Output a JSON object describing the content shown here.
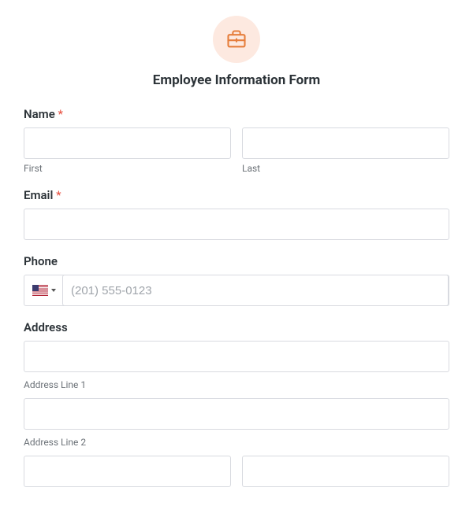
{
  "title": "Employee Information Form",
  "required_mark": "*",
  "fields": {
    "name": {
      "label": "Name",
      "required": true,
      "first_sublabel": "First",
      "last_sublabel": "Last"
    },
    "email": {
      "label": "Email",
      "required": true
    },
    "phone": {
      "label": "Phone",
      "placeholder": "(201) 555-0123"
    },
    "address": {
      "label": "Address",
      "line1_sublabel": "Address Line 1",
      "line2_sublabel": "Address Line 2"
    }
  }
}
